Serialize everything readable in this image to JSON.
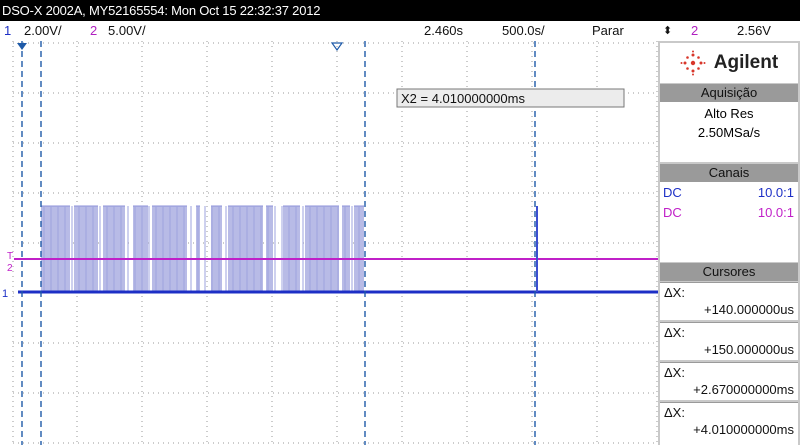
{
  "title": "DSO-X 2002A, MY52165554: Mon Oct 15 22:32:37 2012",
  "status": {
    "ch1_num": "1",
    "ch1_scale": "2.00V/",
    "ch2_num": "2",
    "ch2_scale": "5.00V/",
    "time_pos": "2.460s",
    "time_scale": "500.0s/",
    "run_state": "Parar",
    "trigger_icon": "trigger-edge-icon",
    "trig_channel": "2",
    "trig_level": "2.56V"
  },
  "screen": {
    "cursor_readout": "X2 = 4.010000000ms",
    "ch1_marker": "1",
    "trig_marker": "T",
    "ch2_marker": "2"
  },
  "panel": {
    "brand": "Agilent",
    "acquisition": {
      "header": "Aquisição",
      "mode": "Alto Res",
      "rate": "2.50MSa/s"
    },
    "channels": {
      "header": "Canais",
      "rows": [
        {
          "coupling": "DC",
          "probe": "10.0:1",
          "color": "#1d2fc6"
        },
        {
          "coupling": "DC",
          "probe": "10.0:1",
          "color": "#c020c8"
        }
      ]
    },
    "cursors": {
      "header": "Cursores",
      "rows": [
        {
          "label": "ΔX:",
          "value": "+140.000000us"
        },
        {
          "label": "ΔX:",
          "value": "+150.000000us"
        },
        {
          "label": "ΔX:",
          "value": "+2.670000000ms"
        },
        {
          "label": "ΔX:",
          "value": "+4.010000000ms"
        }
      ]
    }
  },
  "colors": {
    "ch1": "#1d2fc6",
    "ch2": "#c020c8",
    "grid": "#9a9a9a",
    "cursor": "#1e5aa8",
    "signal_fill": "#b8bbe6"
  }
}
